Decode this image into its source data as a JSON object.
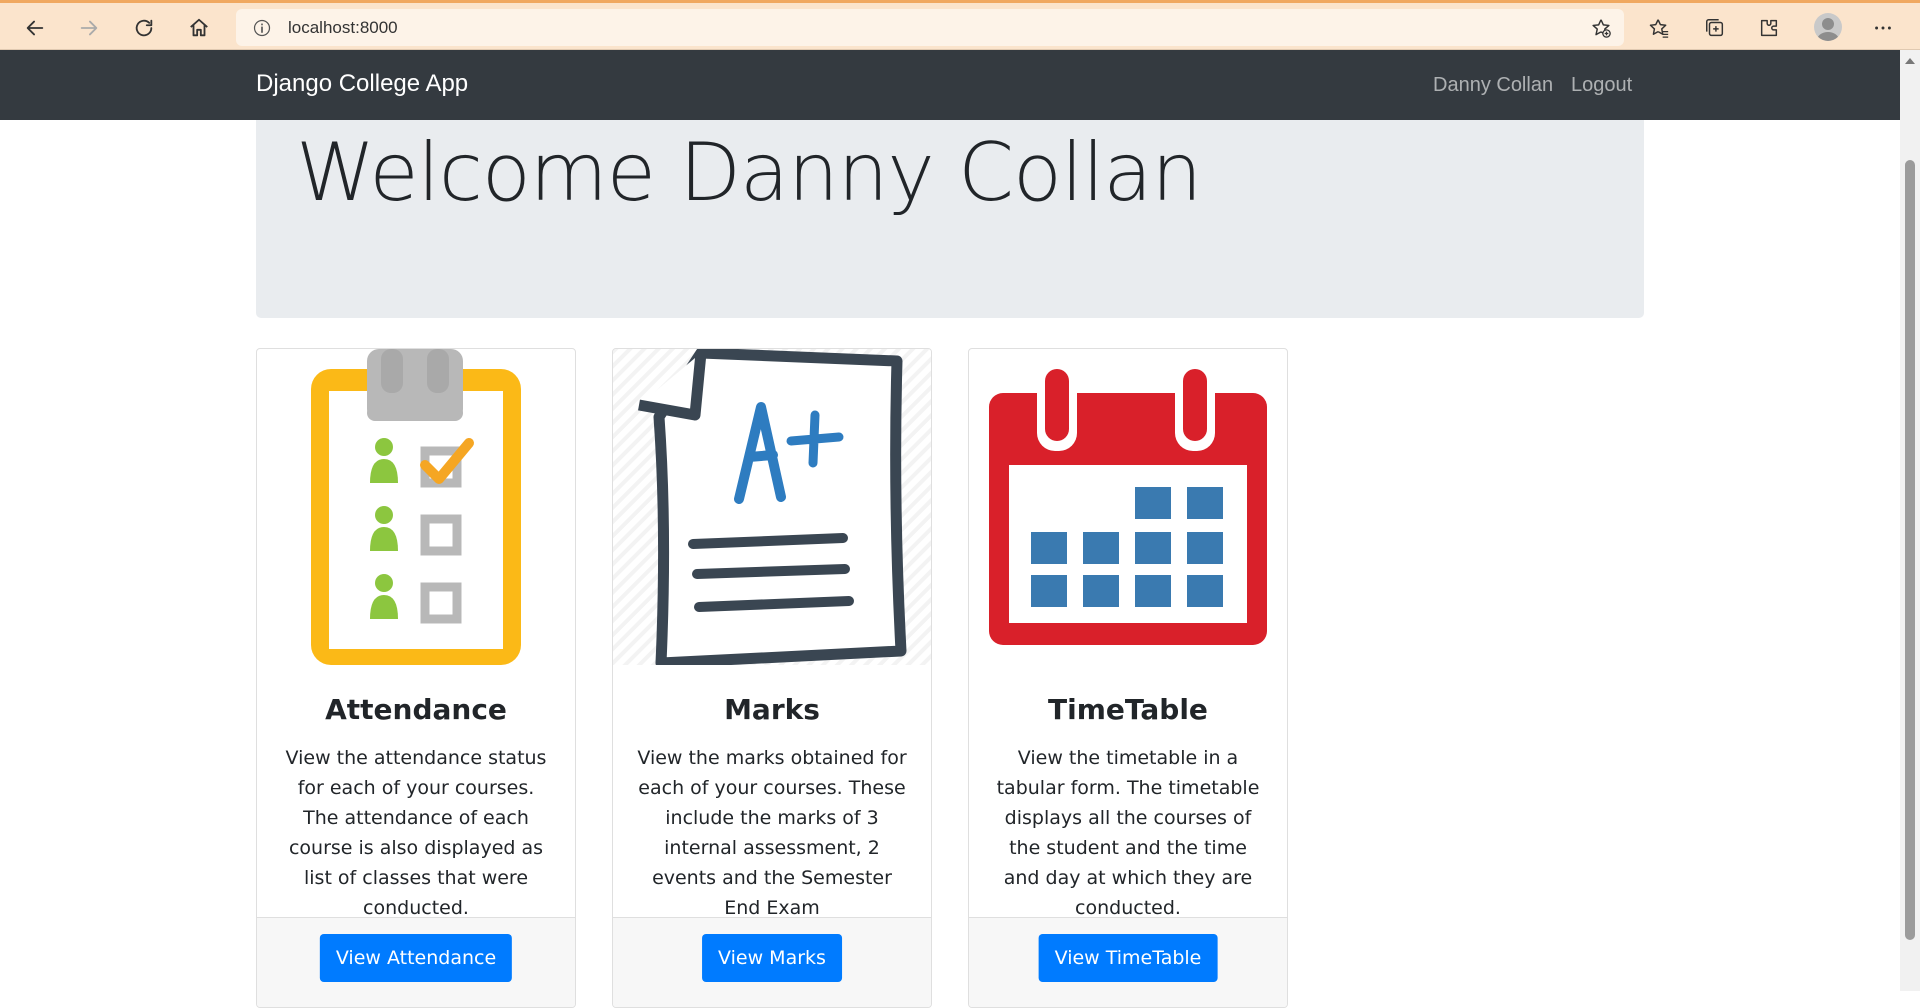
{
  "browser": {
    "url": "localhost:8000",
    "icons": [
      "back-icon",
      "forward-icon",
      "reload-icon",
      "home-icon",
      "info-icon",
      "add-favorite-icon",
      "favorites-icon",
      "collections-icon",
      "extensions-icon",
      "profile-avatar",
      "more-icon"
    ]
  },
  "navbar": {
    "brand": "Django College App",
    "user_name": "Danny Collan",
    "logout": "Logout"
  },
  "jumbotron": {
    "heading": "Welcome Danny Collan"
  },
  "cards": [
    {
      "title": "Attendance",
      "text": "View the attendance status for each of your courses. The attendance of each course is also displayed as list of classes that were conducted.",
      "button": "View Attendance",
      "icon": "clipboard-checklist-icon"
    },
    {
      "title": "Marks",
      "text": "View the marks obtained for each of your courses. These include the marks of 3 internal assessment, 2 events and the Semester End Exam",
      "button": "View Marks",
      "icon": "graded-paper-icon"
    },
    {
      "title": "TimeTable",
      "text": "View the timetable in a tabular form. The timetable displays all the courses of the student and the time and day at which they are conducted.",
      "button": "View TimeTable",
      "icon": "calendar-icon"
    }
  ],
  "colors": {
    "navbar_bg": "#343a40",
    "jumbotron_bg": "#e9ecef",
    "primary": "#007bff",
    "browser_bar": "#fbe4cc"
  }
}
